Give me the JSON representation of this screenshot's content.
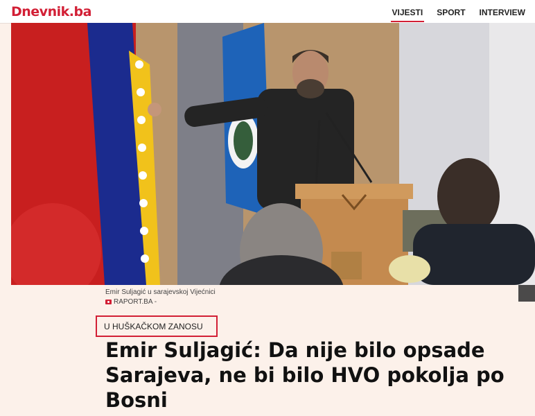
{
  "site": {
    "logo": "Dnevnik.ba"
  },
  "nav": {
    "items": [
      "VIJESTI",
      "SPORT",
      "INTERVIEW"
    ],
    "active": "VIJESTI"
  },
  "article": {
    "image_caption": "Emir Suljagić u sarajevskoj Vijećnici",
    "image_credit": "RAPORT.BA -",
    "category_tag": "U HUŠKAČKOM ZANOSU",
    "headline": "Emir Suljagić: Da nije bilo opsade Sarajeva, ne bi bilo HVO pokolja po Bosni"
  },
  "colors": {
    "brand": "#d21f35",
    "background": "#fcf1ea"
  }
}
